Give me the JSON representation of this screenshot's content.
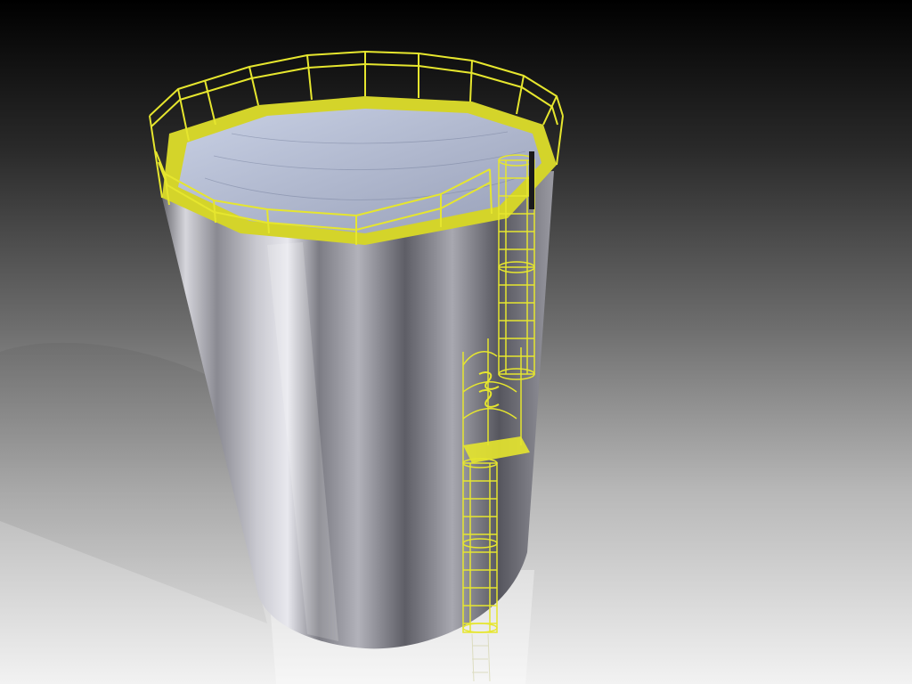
{
  "scene": {
    "description_colors": {
      "background_top": "#000000",
      "background_bottom": "#f2f2f2",
      "tank_metal": "#9a9aa2",
      "railing_yellow": "#e6e62e",
      "roof_surface": "#b4bcd2",
      "shadow": "#8c8c8c"
    }
  }
}
